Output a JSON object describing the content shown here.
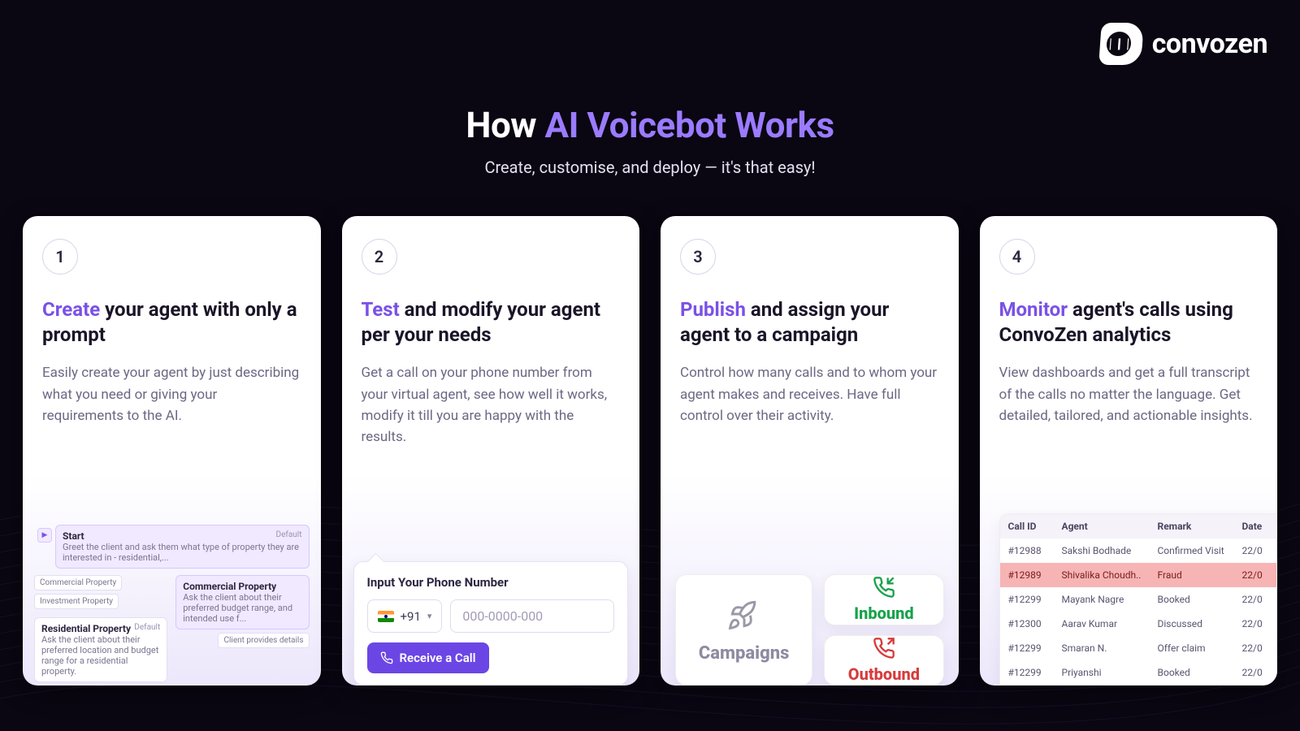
{
  "brand": {
    "name": "convozen"
  },
  "header": {
    "title_prefix": "How ",
    "title_accent": "AI Voicebot Works",
    "subtitle": "Create, customise, and deploy — it's that easy!"
  },
  "cards": [
    {
      "num": "1",
      "keyword": "Create",
      "heading_rest": " your agent with only a prompt",
      "body": "Easily create your agent by just describing what you need or giving your requirements to the AI."
    },
    {
      "num": "2",
      "keyword": "Test",
      "heading_rest": " and modify your agent per your needs",
      "body": "Get a call on your phone number from your virtual agent, see how well it works, modify it till you are happy with the results."
    },
    {
      "num": "3",
      "keyword": "Publish",
      "heading_rest": " and assign your agent to a campaign",
      "body": "Control how many calls and to whom your agent makes and receives. Have full control over their activity."
    },
    {
      "num": "4",
      "keyword": "Monitor",
      "heading_rest": " agent's calls using ConvoZen analytics",
      "body": "View dashboards and get a full transcript of the calls no matter the language. Get detailed, tailored, and actionable insights."
    }
  ],
  "flow": {
    "start_title": "Start",
    "default": "Default",
    "start_desc": "Greet the client and ask them what type of property they are interested in - residential,...",
    "chip_commercial": "Commercial Property",
    "chip_investment": "Investment Property",
    "cp_title": "Commercial Property",
    "cp_desc": "Ask the client about their preferred budget range, and intended use f...",
    "chip_client": "Client provides details",
    "rp_title": "Residential Property",
    "rp_desc": "Ask the client about their preferred location and budget range for a residential property."
  },
  "phone": {
    "label": "Input Your Phone Number",
    "cc": "+91",
    "placeholder": "000-0000-000",
    "button": "Receive a Call"
  },
  "campaigns": {
    "label": "Campaigns",
    "inbound": "Inbound",
    "outbound": "Outbound"
  },
  "table": {
    "headers": {
      "id": "Call ID",
      "agent": "Agent",
      "remark": "Remark",
      "date": "Date"
    },
    "rows": [
      {
        "id": "#12988",
        "agent": "Sakshi Bodhade",
        "remark": "Confirmed Visit",
        "date": "22/0",
        "flag": ""
      },
      {
        "id": "#12989",
        "agent": "Shivalika Choudh..",
        "remark": "Fraud",
        "date": "22/0",
        "flag": "fraud"
      },
      {
        "id": "#12299",
        "agent": "Mayank Nagre",
        "remark": "Booked",
        "date": "22/0",
        "flag": ""
      },
      {
        "id": "#12300",
        "agent": "Aarav Kumar",
        "remark": "Discussed",
        "date": "22/0",
        "flag": ""
      },
      {
        "id": "#12299",
        "agent": "Smaran N.",
        "remark": "Offer claim",
        "date": "22/0",
        "flag": ""
      },
      {
        "id": "#12299",
        "agent": "Priyanshi",
        "remark": "Booked",
        "date": "22/0",
        "flag": ""
      }
    ]
  }
}
